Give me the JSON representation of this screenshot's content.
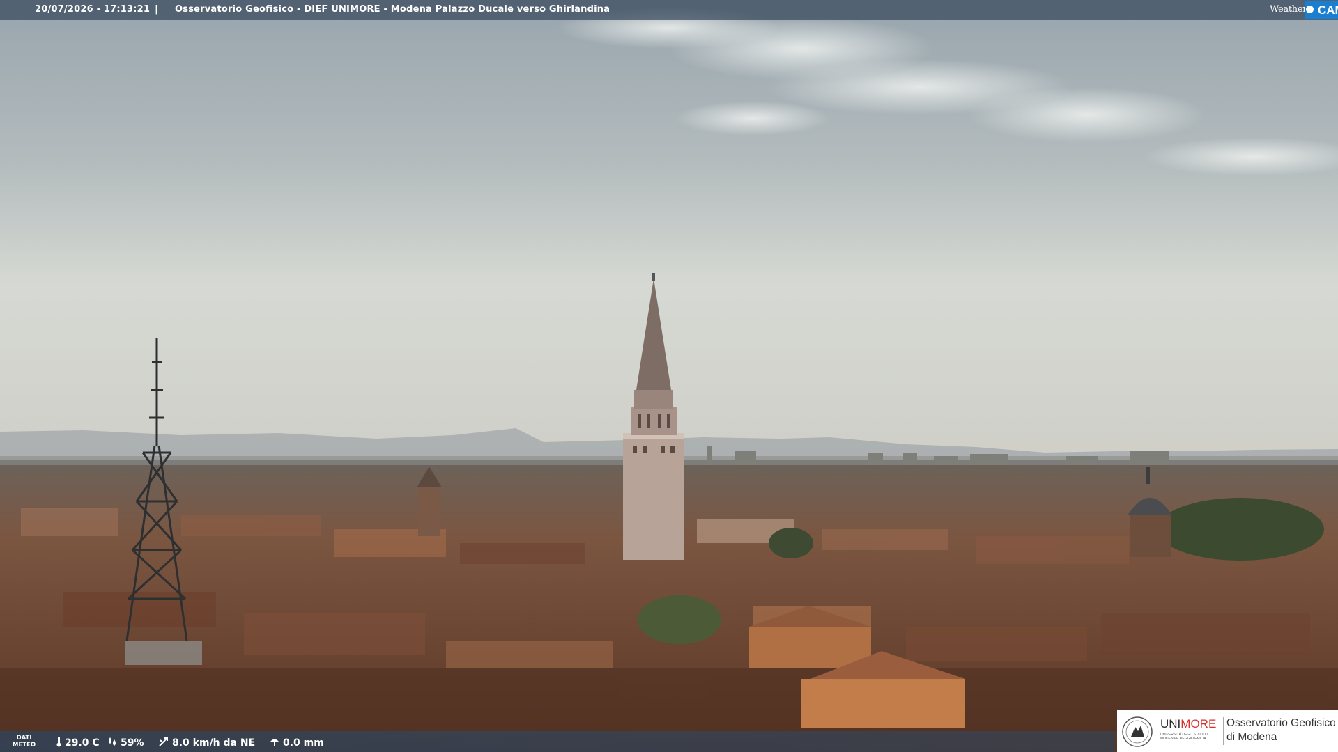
{
  "overlay": {
    "timestamp": "20/07/2026 - 17:13:21",
    "separator": "|",
    "title": "Osservatorio Geofisico - DIEF UNIMORE - Modena Palazzo Ducale verso Ghirlandina"
  },
  "logo": {
    "word": "Weather",
    "cam": "CAM"
  },
  "weather": {
    "label_line1": "DATI",
    "label_line2": "METEO",
    "temperature": "29.0 C",
    "humidity": "59%",
    "wind": "8.0 km/h da NE",
    "rain": "0.0 mm"
  },
  "institution": {
    "brand_a": "UNI",
    "brand_b": "MORE",
    "subtitle": "UNIVERSITÀ DEGLI STUDI DI MODENA E REGGIO EMILIA",
    "name_line1": "Osservatorio Geofisico",
    "name_line2": "di Modena"
  },
  "colors": {
    "sky_top": "#9eaab1",
    "sky_horizon": "#d8dcd6",
    "roofs": "#7a4a32",
    "unimore_red": "#d9322c",
    "cam_blue": "#1a7fd1"
  },
  "icons": [
    "thermometer-icon",
    "humidity-drops-icon",
    "wind-icon",
    "rain-gauge-icon",
    "weathercam-dot-icon",
    "university-seal-icon"
  ]
}
